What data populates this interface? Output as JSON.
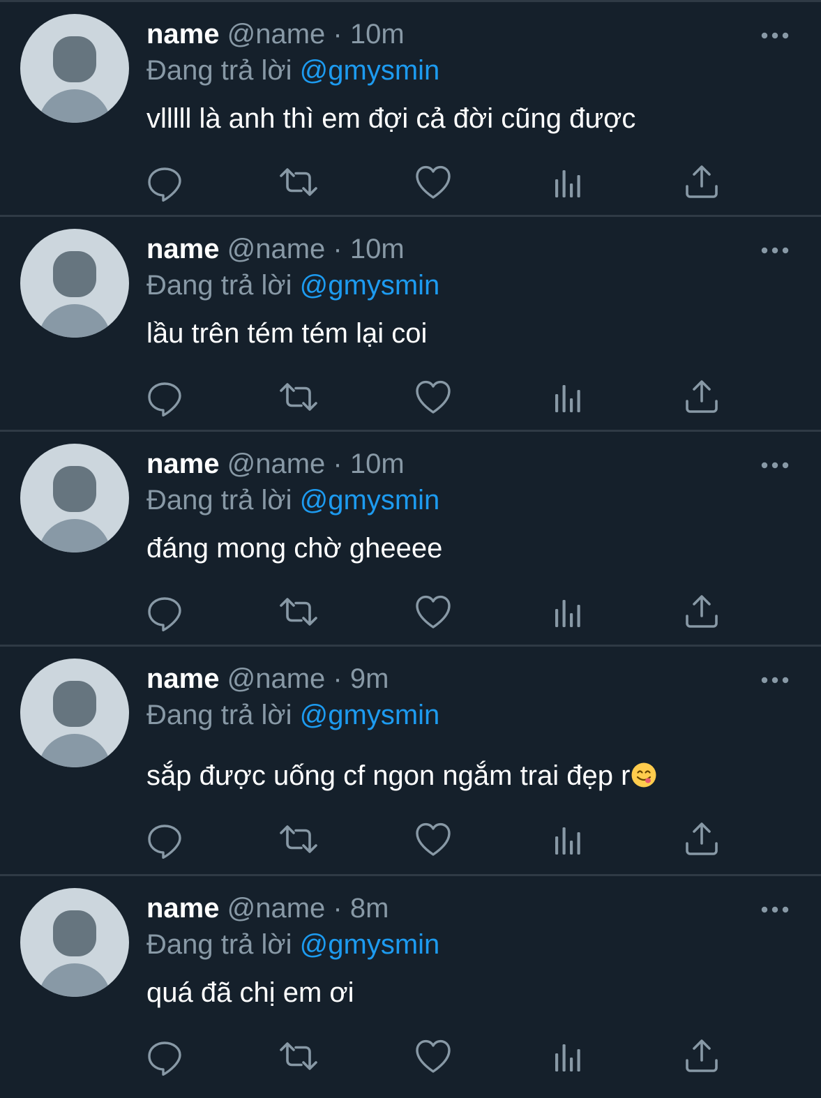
{
  "colors": {
    "background": "#15202b",
    "divider": "#2f3a45",
    "text": "#ffffff",
    "muted": "#8899a6",
    "mention": "#1d9bf0"
  },
  "reply_prefix": "Đang trả lời",
  "tweets": [
    {
      "display_name": "name",
      "handle": "@name",
      "time": "10m",
      "reply_to": "@gmysmin",
      "text": "vlllll là anh thì em đợi cả đời cũng được"
    },
    {
      "display_name": "name",
      "handle": "@name",
      "time": "10m",
      "reply_to": "@gmysmin",
      "text": "lầu trên tém tém lại coi"
    },
    {
      "display_name": "name",
      "handle": "@name",
      "time": "10m",
      "reply_to": "@gmysmin",
      "text": "đáng mong chờ gheeee"
    },
    {
      "display_name": "name",
      "handle": "@name",
      "time": "9m",
      "reply_to": "@gmysmin",
      "text": "sắp được uống cf ngon ngắm trai đẹp r",
      "emoji": "yum-face-emoji"
    },
    {
      "display_name": "name",
      "handle": "@name",
      "time": "8m",
      "reply_to": "@gmysmin",
      "text": "quá đã chị em ơi"
    }
  ],
  "icons": {
    "more": "more-dots-icon",
    "reply": "reply-bubble-icon",
    "retweet": "retweet-icon",
    "like": "heart-icon",
    "views": "views-bars-icon",
    "share": "share-upload-icon"
  }
}
